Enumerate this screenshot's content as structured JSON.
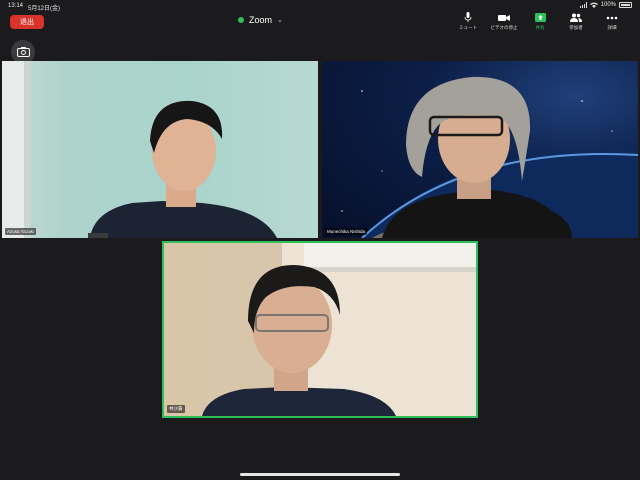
{
  "status_bar": {
    "time": "13:14",
    "date": "5月12日(金)",
    "battery": "100%"
  },
  "top_bar": {
    "leave_label": "退出",
    "app_title": "Zoom"
  },
  "toolbar": [
    {
      "name": "mute",
      "label": "ミュート",
      "icon": "mic-icon"
    },
    {
      "name": "video",
      "label": "ビデオの停止",
      "icon": "video-camera-icon"
    },
    {
      "name": "share",
      "label": "共有",
      "icon": "share-screen-icon",
      "color": "#2ec15a"
    },
    {
      "name": "participants",
      "label": "参加者",
      "icon": "participants-icon"
    },
    {
      "name": "more",
      "label": "詳細",
      "icon": "more-dots-icon"
    }
  ],
  "side_buttons": [
    {
      "name": "switch-camera",
      "icon": "camera-switch-icon"
    },
    {
      "name": "gallery-view",
      "icon": "gallery-view-icon"
    }
  ],
  "participants": [
    {
      "name": "Azusa Yazaki"
    },
    {
      "name": "Munechika Nishida"
    },
    {
      "name": "林沙貴"
    }
  ],
  "colors": {
    "leave": "#d9342b",
    "active_speaker": "#2ec15a",
    "background": "#1b1b1d"
  }
}
